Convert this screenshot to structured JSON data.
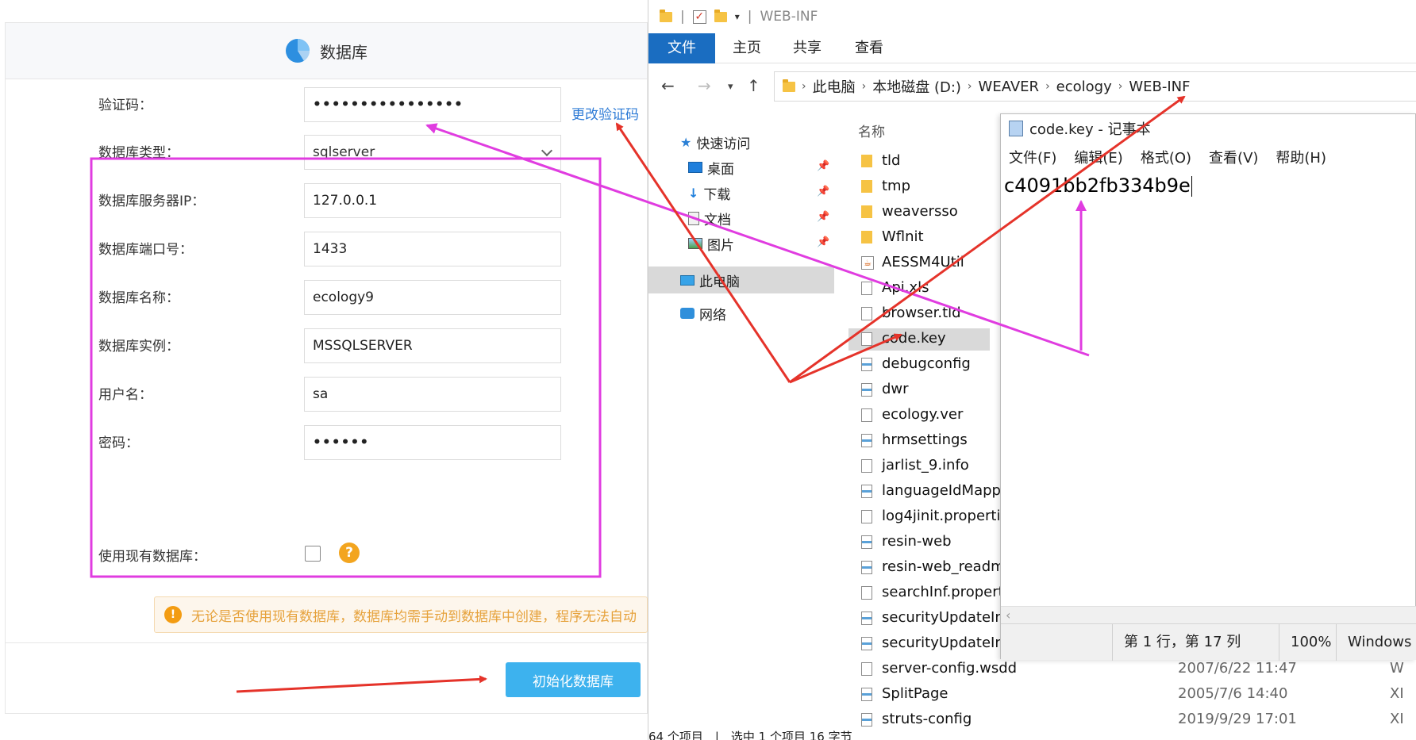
{
  "web": {
    "title": "数据库",
    "change_code_link": "更改验证码",
    "fields": [
      {
        "label": "验证码：",
        "value": "••••••••••••••••"
      },
      {
        "label": "数据库类型：",
        "value": "sqlserver"
      },
      {
        "label": "数据库服务器IP：",
        "value": "127.0.0.1"
      },
      {
        "label": "数据库端口号：",
        "value": "1433"
      },
      {
        "label": "数据库名称：",
        "value": "ecology9"
      },
      {
        "label": "数据库实例：",
        "value": "MSSQLSERVER"
      },
      {
        "label": "用户名：",
        "value": "sa"
      },
      {
        "label": "密码：",
        "value": "••••••"
      }
    ],
    "use_existing_label": "使用现有数据库：",
    "help_glyph": "?",
    "notice_glyph": "!",
    "notice": "无论是否使用现有数据库，数据库均需手动到数据库中创建，程序无法自动",
    "init_button": "初始化数据库",
    "colors": {
      "accent": "#3db2ee",
      "highlight": "#e03ce0",
      "arrow_red": "#e5332a"
    }
  },
  "explorer": {
    "window_title": "WEB-INF",
    "ribbon_tabs": [
      "文件",
      "主页",
      "共享",
      "查看"
    ],
    "breadcrumb": [
      "此电脑",
      "本地磁盘 (D:)",
      "WEAVER",
      "ecology",
      "WEB-INF"
    ],
    "nav_items": [
      {
        "label": "快速访问"
      },
      {
        "label": "桌面"
      },
      {
        "label": "下载"
      },
      {
        "label": "文档"
      },
      {
        "label": "图片"
      },
      {
        "label": "此电脑"
      },
      {
        "label": "网络"
      }
    ],
    "column_name": "名称",
    "files": [
      {
        "name": "tld",
        "icon": "folder",
        "date": "",
        "type": ""
      },
      {
        "name": "tmp",
        "icon": "folder",
        "date": "",
        "type": ""
      },
      {
        "name": "weaversso",
        "icon": "folder",
        "date": "",
        "type": ""
      },
      {
        "name": "Wflnit",
        "icon": "folder",
        "date": "",
        "type": ""
      },
      {
        "name": "AESSM4Util",
        "icon": "java",
        "date": "",
        "type": ""
      },
      {
        "name": "Api.xls",
        "icon": "file",
        "date": "",
        "type": ""
      },
      {
        "name": "browser.tld",
        "icon": "file",
        "date": "",
        "type": ""
      },
      {
        "name": "code.key",
        "icon": "file",
        "date": "",
        "type": ""
      },
      {
        "name": "debugconfig",
        "icon": "xml",
        "date": "",
        "type": ""
      },
      {
        "name": "dwr",
        "icon": "xml",
        "date": "",
        "type": ""
      },
      {
        "name": "ecology.ver",
        "icon": "file",
        "date": "",
        "type": ""
      },
      {
        "name": "hrmsettings",
        "icon": "xml",
        "date": "",
        "type": ""
      },
      {
        "name": "jarlist_9.info",
        "icon": "file",
        "date": "",
        "type": ""
      },
      {
        "name": "languageIdMapp",
        "icon": "xml",
        "date": "",
        "type": ""
      },
      {
        "name": "log4jinit.properti",
        "icon": "file",
        "date": "",
        "type": ""
      },
      {
        "name": "resin-web",
        "icon": "xml",
        "date": "",
        "type": ""
      },
      {
        "name": "resin-web_readm",
        "icon": "xml",
        "date": "",
        "type": ""
      },
      {
        "name": "searchInf.propert",
        "icon": "file",
        "date": "",
        "type": ""
      },
      {
        "name": "securityUpdateIn",
        "icon": "xml",
        "date": "",
        "type": ""
      },
      {
        "name": "securityUpdateIn",
        "icon": "xml",
        "date": "",
        "type": ""
      },
      {
        "name": "server-config.wsdd",
        "icon": "file",
        "date": "2007/6/22 11:47",
        "type": "W"
      },
      {
        "name": "SplitPage",
        "icon": "xml",
        "date": "2005/7/6 14:40",
        "type": "XI"
      },
      {
        "name": "struts-config",
        "icon": "xml",
        "date": "2019/9/29 17:01",
        "type": "XI"
      }
    ],
    "status": "64 个项目　|　选中 1 个项目  16 字节"
  },
  "notepad": {
    "title": "code.key - 记事本",
    "menu": [
      "文件(F)",
      "编辑(E)",
      "格式(O)",
      "查看(V)",
      "帮助(H)"
    ],
    "content": "c4091bb2fb334b9e",
    "status_position": "第 1 行，第 17 列",
    "status_zoom": "100%",
    "status_encoding": "Windows ("
  }
}
